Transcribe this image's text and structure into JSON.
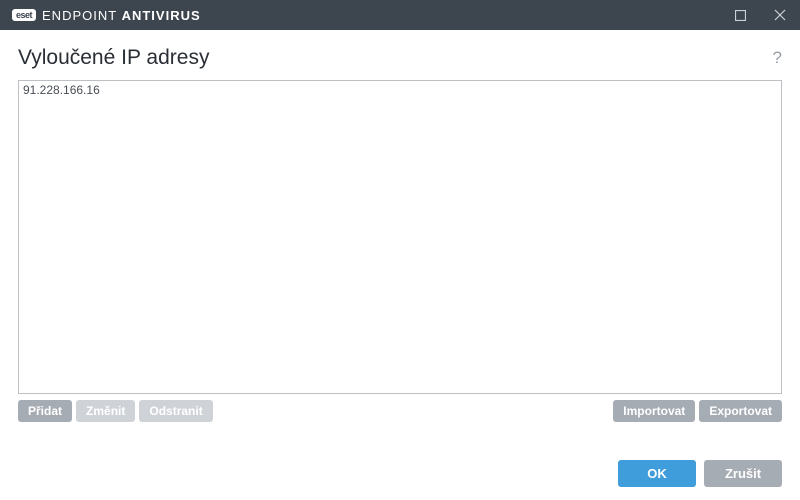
{
  "titlebar": {
    "logo": "eset",
    "product_light": "ENDPOINT ",
    "product_bold": "ANTIVIRUS"
  },
  "heading": "Vyloučené IP adresy",
  "help_tooltip": "?",
  "ip_list": {
    "items": [
      "91.228.166.16"
    ]
  },
  "actions": {
    "add": "Přidat",
    "edit": "Změnit",
    "remove": "Odstranit",
    "import": "Importovat",
    "export": "Exportovat"
  },
  "footer": {
    "ok": "OK",
    "cancel": "Zrušit"
  }
}
